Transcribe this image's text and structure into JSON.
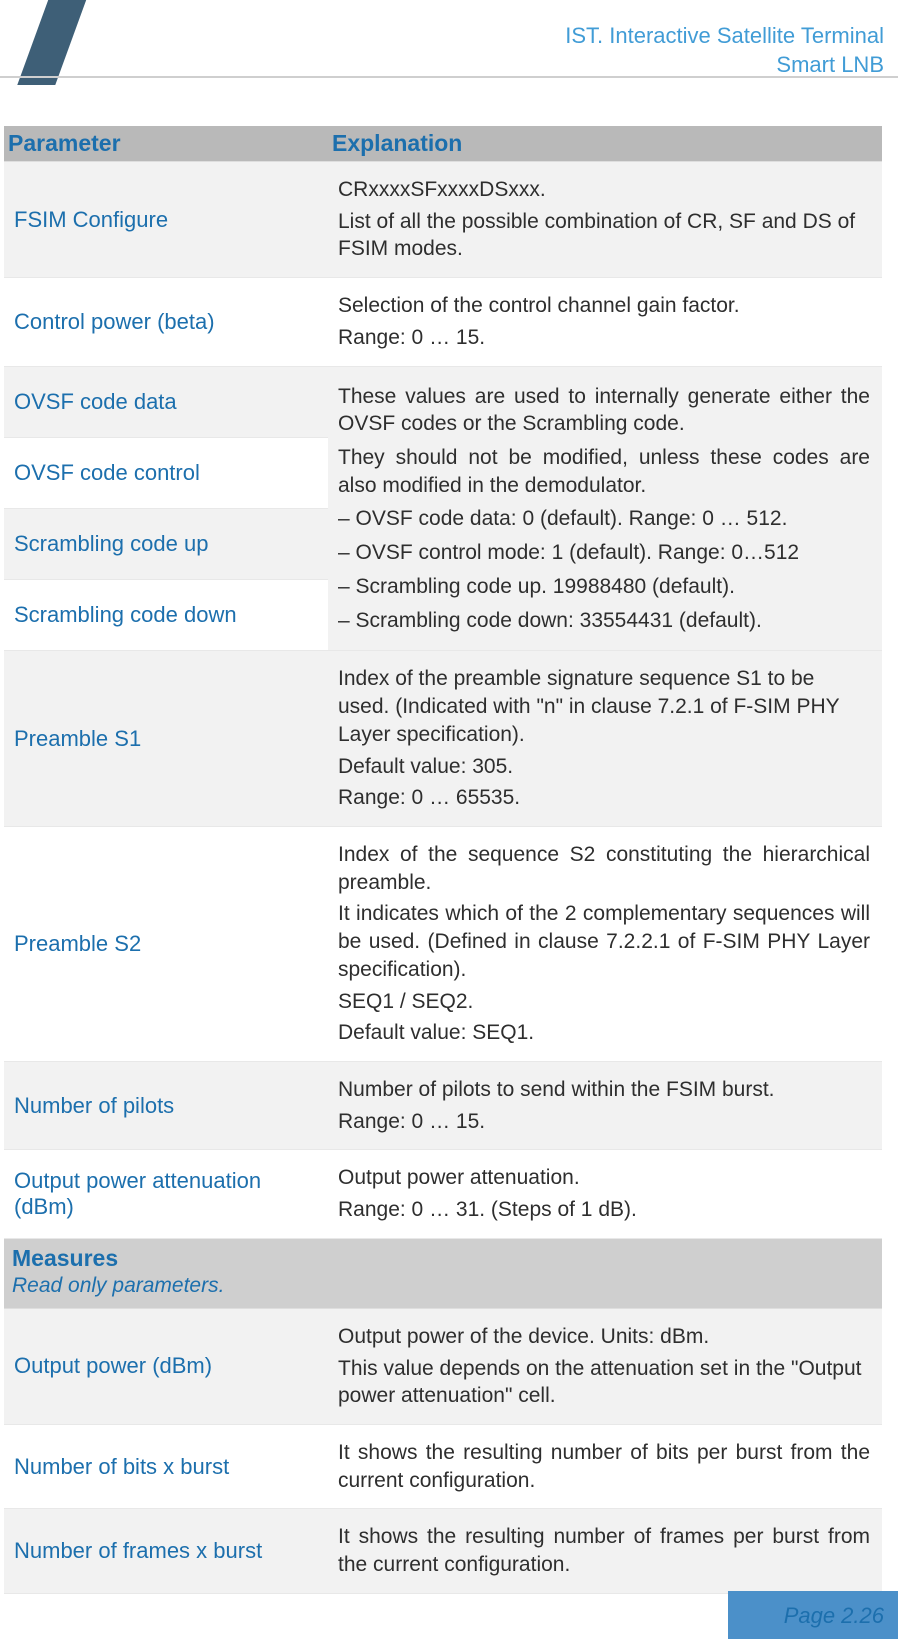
{
  "header": {
    "title_line1": "IST. Interactive Satellite Terminal",
    "title_line2": "Smart LNB"
  },
  "table": {
    "col_parameter": "Parameter",
    "col_explanation": "Explanation",
    "rows": [
      {
        "param": "FSIM Configure",
        "expl": [
          "CRxxxxSFxxxxDSxxx.",
          "List of all the possible combination of CR, SF and DS of FSIM modes."
        ]
      },
      {
        "param": "Control power (beta)",
        "expl": [
          "Selection of the control channel gain factor.",
          "Range: 0 … 15."
        ]
      },
      {
        "param_group": [
          "OVSF code data",
          "OVSF code control",
          "Scrambling code up",
          "Scrambling code down"
        ],
        "expl": [
          "These values are used to internally generate either the OVSF codes or the Scrambling code.",
          "They should not be modified, unless these codes are also modified in the demodulator.",
          "OVSF code data: 0 (default). Range: 0 … 512.",
          "OVSF control mode: 1 (default). Range: 0…512",
          "Scrambling code up. 19988480 (default).",
          "Scrambling code down: 33554431 (default)."
        ]
      },
      {
        "param": "Preamble S1",
        "expl": [
          "Index of the preamble signature sequence S1 to be used. (Indicated with \"n\" in clause 7.2.1 of F-SIM PHY Layer specification).",
          "Default value: 305.",
          "Range: 0 … 65535."
        ]
      },
      {
        "param": "Preamble S2",
        "expl": [
          "Index of the sequence S2 constituting the hierarchical preamble.",
          "It indicates which of the 2 complementary sequences will be used. (Defined in clause 7.2.2.1 of F-SIM PHY Layer specification).",
          "SEQ1 / SEQ2.",
          "Default value: SEQ1."
        ]
      },
      {
        "param": "Number of pilots",
        "expl": [
          "Number of pilots to send within the FSIM burst.",
          "Range: 0 … 15."
        ]
      },
      {
        "param": "Output power attenuation (dBm)",
        "expl": [
          "Output power attenuation.",
          "Range: 0 … 31. (Steps of 1 dB)."
        ]
      }
    ],
    "section": {
      "title": "Measures",
      "subtitle": "Read only parameters."
    },
    "rows2": [
      {
        "param": "Output power (dBm)",
        "expl": [
          "Output power of the device. Units: dBm.",
          "This value depends on the attenuation set in the \"Output power attenuation\" cell."
        ]
      },
      {
        "param": "Number of bits x burst",
        "expl": [
          "It shows the resulting number of bits per burst from the current configuration."
        ]
      },
      {
        "param": "Number of frames x burst",
        "expl": [
          "It shows the resulting number of frames per burst from the current configuration."
        ]
      }
    ]
  },
  "footer": {
    "page": "Page 2.26"
  }
}
